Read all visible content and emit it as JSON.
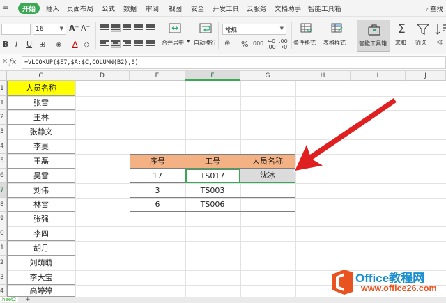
{
  "menu": {
    "tabs": [
      "开始",
      "插入",
      "页面布局",
      "公式",
      "数据",
      "审阅",
      "视图",
      "安全",
      "开发工具",
      "云服务",
      "文档助手",
      "智能工具箱"
    ],
    "active_tab": "开始",
    "find_label": "查找"
  },
  "ribbon": {
    "font_size": "16",
    "number_format": "常规",
    "merge_label": "合并居中",
    "wrap_label": "自动换行",
    "cond_format_label": "条件格式",
    "table_style_label": "表格样式",
    "smart_toolbox_label": "智能工具箱",
    "sum_label": "求和",
    "filter_label": "筛选",
    "sort_label": "排"
  },
  "formula": {
    "value": "=VLOOKUP($E7,$A:$C,COLUMN(B2),0)"
  },
  "columns": [
    "C",
    "D",
    "E",
    "F",
    "G",
    "H",
    "I",
    "J"
  ],
  "selected_column": "F",
  "row_numbers": [
    "1",
    "1",
    "2",
    "3",
    "4",
    "5",
    "6",
    "7",
    "8",
    "9",
    "0",
    "1",
    "2",
    "3",
    "4",
    "5"
  ],
  "selected_row_index": 7,
  "names": {
    "header": "人员名称",
    "list": [
      "张雪",
      "王林",
      "张静文",
      "李昊",
      "王磊",
      "吴雪",
      "刘伟",
      "林雪",
      "张强",
      "李四",
      "胡月",
      "刘萌萌",
      "李大宝",
      "高婷婷"
    ]
  },
  "lookup_table": {
    "headers": [
      "序号",
      "工号",
      "人员名称"
    ],
    "rows": [
      [
        "17",
        "TS017",
        "沈冰"
      ],
      [
        "3",
        "TS003",
        ""
      ],
      [
        "6",
        "TS006",
        ""
      ]
    ]
  },
  "sheet": {
    "tab_label": "heet2"
  },
  "watermark": {
    "brand": "Office教程网",
    "url": "www.office26.com"
  },
  "colors": {
    "accent_green": "#3aa855",
    "name_header_fill": "#ffff00",
    "table_header_fill": "#f4b183",
    "arrow_red": "#e02020"
  }
}
